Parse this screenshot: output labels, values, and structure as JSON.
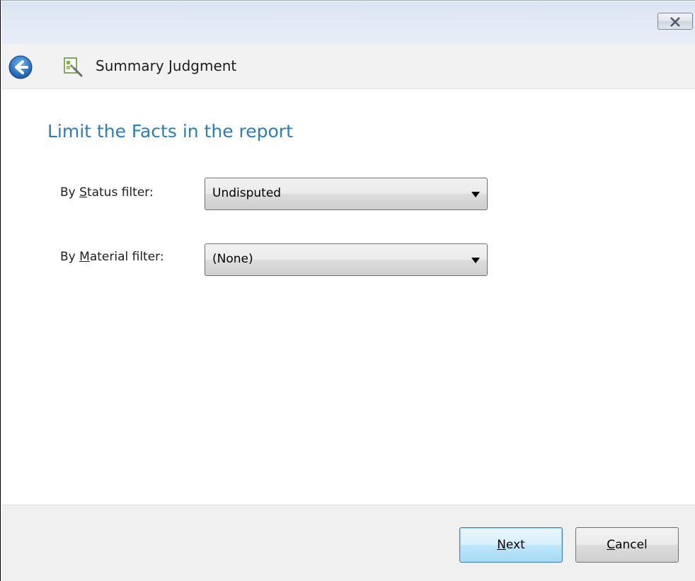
{
  "window": {
    "close_icon": "close-icon"
  },
  "header": {
    "back_icon": "back-arrow-icon",
    "app_icon": "wizard-icon",
    "title": "Summary Judgment"
  },
  "content": {
    "page_title": "Limit the Facts in the report",
    "status_filter": {
      "label_prefix": "By ",
      "label_mnemonic": "S",
      "label_rest": "tatus filter:",
      "value": "Undisputed"
    },
    "material_filter": {
      "label_prefix": "By ",
      "label_mnemonic": "M",
      "label_rest": "aterial filter:",
      "value": "(None)"
    }
  },
  "footer": {
    "next": {
      "mnemonic": "N",
      "rest": "ext"
    },
    "cancel": {
      "mnemonic": "C",
      "rest": "ancel"
    }
  },
  "colors": {
    "title_blue": "#2e7db6",
    "back_button_blue": "#1f6fc7"
  }
}
